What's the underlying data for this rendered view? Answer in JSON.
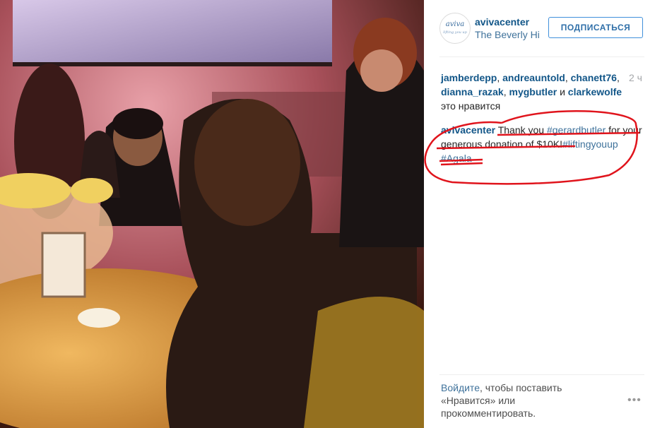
{
  "post": {
    "image_alt": "Gala dinner photo",
    "author": "avivacenter",
    "location": "The Beverly Hilton",
    "follow_label": "ПОДПИСАТЬСЯ",
    "avatar_text": "aviva",
    "avatar_subtext": "lifting you up"
  },
  "likes": {
    "users": [
      "jamberdepp",
      "andreauntold",
      "chanett76",
      "dianna_razak",
      "mygbutler",
      "clarkewolfe"
    ],
    "and_word": "и",
    "suffix": "это нравится",
    "time": "2 ч"
  },
  "caption": {
    "author": "avivacenter",
    "text1": "Thank you ",
    "mention": "#gerardbutler",
    "text2": " for your generous donation of $10K!",
    "tag1": "#liftingyouup",
    "space": " ",
    "tag2": "#Agala"
  },
  "footer": {
    "login_link": "Войдите",
    "login_text": ", чтобы поставить «Нравится» или прокомментировать.",
    "more_label": "•••"
  },
  "colors": {
    "link": "#125688",
    "tag": "#3f729b",
    "annotation": "#e0141c",
    "follow_border": "#4090db"
  }
}
